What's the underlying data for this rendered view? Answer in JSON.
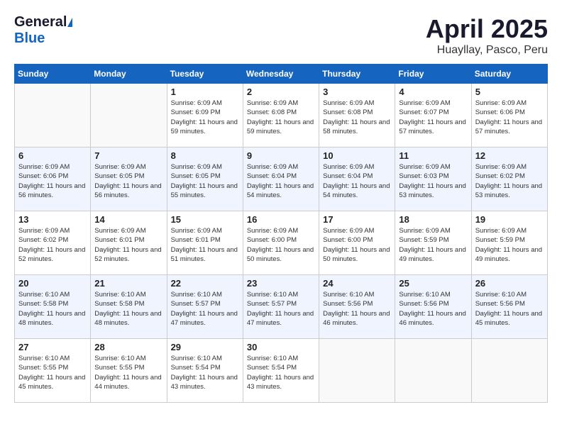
{
  "header": {
    "logo_general": "General",
    "logo_blue": "Blue",
    "month": "April 2025",
    "location": "Huayllay, Pasco, Peru"
  },
  "days_of_week": [
    "Sunday",
    "Monday",
    "Tuesday",
    "Wednesday",
    "Thursday",
    "Friday",
    "Saturday"
  ],
  "weeks": [
    [
      {
        "num": "",
        "info": ""
      },
      {
        "num": "",
        "info": ""
      },
      {
        "num": "1",
        "info": "Sunrise: 6:09 AM\nSunset: 6:09 PM\nDaylight: 11 hours and 59 minutes."
      },
      {
        "num": "2",
        "info": "Sunrise: 6:09 AM\nSunset: 6:08 PM\nDaylight: 11 hours and 59 minutes."
      },
      {
        "num": "3",
        "info": "Sunrise: 6:09 AM\nSunset: 6:08 PM\nDaylight: 11 hours and 58 minutes."
      },
      {
        "num": "4",
        "info": "Sunrise: 6:09 AM\nSunset: 6:07 PM\nDaylight: 11 hours and 57 minutes."
      },
      {
        "num": "5",
        "info": "Sunrise: 6:09 AM\nSunset: 6:06 PM\nDaylight: 11 hours and 57 minutes."
      }
    ],
    [
      {
        "num": "6",
        "info": "Sunrise: 6:09 AM\nSunset: 6:06 PM\nDaylight: 11 hours and 56 minutes."
      },
      {
        "num": "7",
        "info": "Sunrise: 6:09 AM\nSunset: 6:05 PM\nDaylight: 11 hours and 56 minutes."
      },
      {
        "num": "8",
        "info": "Sunrise: 6:09 AM\nSunset: 6:05 PM\nDaylight: 11 hours and 55 minutes."
      },
      {
        "num": "9",
        "info": "Sunrise: 6:09 AM\nSunset: 6:04 PM\nDaylight: 11 hours and 54 minutes."
      },
      {
        "num": "10",
        "info": "Sunrise: 6:09 AM\nSunset: 6:04 PM\nDaylight: 11 hours and 54 minutes."
      },
      {
        "num": "11",
        "info": "Sunrise: 6:09 AM\nSunset: 6:03 PM\nDaylight: 11 hours and 53 minutes."
      },
      {
        "num": "12",
        "info": "Sunrise: 6:09 AM\nSunset: 6:02 PM\nDaylight: 11 hours and 53 minutes."
      }
    ],
    [
      {
        "num": "13",
        "info": "Sunrise: 6:09 AM\nSunset: 6:02 PM\nDaylight: 11 hours and 52 minutes."
      },
      {
        "num": "14",
        "info": "Sunrise: 6:09 AM\nSunset: 6:01 PM\nDaylight: 11 hours and 52 minutes."
      },
      {
        "num": "15",
        "info": "Sunrise: 6:09 AM\nSunset: 6:01 PM\nDaylight: 11 hours and 51 minutes."
      },
      {
        "num": "16",
        "info": "Sunrise: 6:09 AM\nSunset: 6:00 PM\nDaylight: 11 hours and 50 minutes."
      },
      {
        "num": "17",
        "info": "Sunrise: 6:09 AM\nSunset: 6:00 PM\nDaylight: 11 hours and 50 minutes."
      },
      {
        "num": "18",
        "info": "Sunrise: 6:09 AM\nSunset: 5:59 PM\nDaylight: 11 hours and 49 minutes."
      },
      {
        "num": "19",
        "info": "Sunrise: 6:09 AM\nSunset: 5:59 PM\nDaylight: 11 hours and 49 minutes."
      }
    ],
    [
      {
        "num": "20",
        "info": "Sunrise: 6:10 AM\nSunset: 5:58 PM\nDaylight: 11 hours and 48 minutes."
      },
      {
        "num": "21",
        "info": "Sunrise: 6:10 AM\nSunset: 5:58 PM\nDaylight: 11 hours and 48 minutes."
      },
      {
        "num": "22",
        "info": "Sunrise: 6:10 AM\nSunset: 5:57 PM\nDaylight: 11 hours and 47 minutes."
      },
      {
        "num": "23",
        "info": "Sunrise: 6:10 AM\nSunset: 5:57 PM\nDaylight: 11 hours and 47 minutes."
      },
      {
        "num": "24",
        "info": "Sunrise: 6:10 AM\nSunset: 5:56 PM\nDaylight: 11 hours and 46 minutes."
      },
      {
        "num": "25",
        "info": "Sunrise: 6:10 AM\nSunset: 5:56 PM\nDaylight: 11 hours and 46 minutes."
      },
      {
        "num": "26",
        "info": "Sunrise: 6:10 AM\nSunset: 5:56 PM\nDaylight: 11 hours and 45 minutes."
      }
    ],
    [
      {
        "num": "27",
        "info": "Sunrise: 6:10 AM\nSunset: 5:55 PM\nDaylight: 11 hours and 45 minutes."
      },
      {
        "num": "28",
        "info": "Sunrise: 6:10 AM\nSunset: 5:55 PM\nDaylight: 11 hours and 44 minutes."
      },
      {
        "num": "29",
        "info": "Sunrise: 6:10 AM\nSunset: 5:54 PM\nDaylight: 11 hours and 43 minutes."
      },
      {
        "num": "30",
        "info": "Sunrise: 6:10 AM\nSunset: 5:54 PM\nDaylight: 11 hours and 43 minutes."
      },
      {
        "num": "",
        "info": ""
      },
      {
        "num": "",
        "info": ""
      },
      {
        "num": "",
        "info": ""
      }
    ]
  ]
}
